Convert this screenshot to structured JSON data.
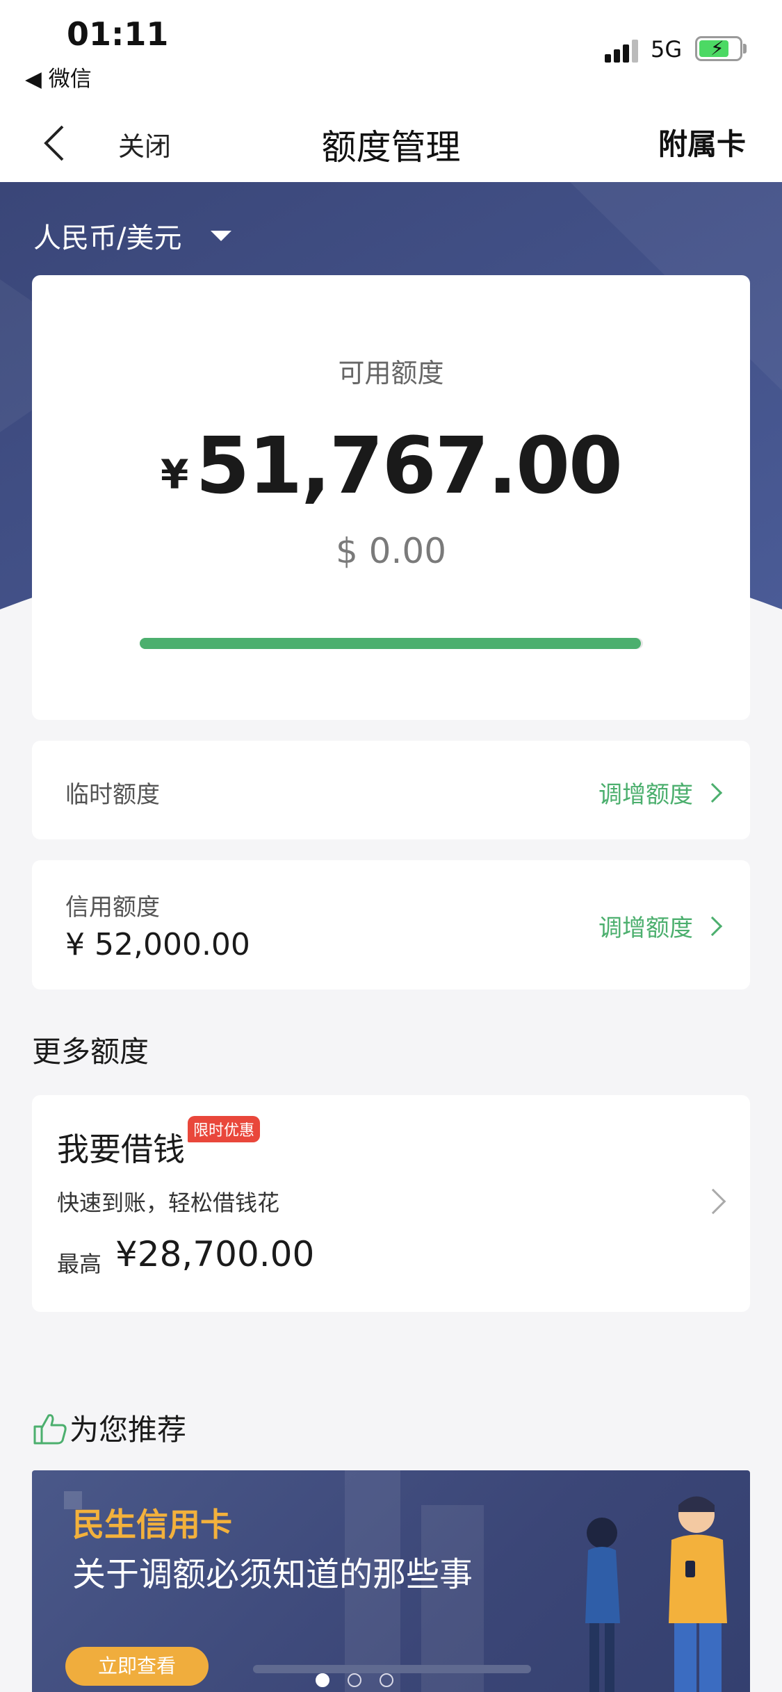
{
  "status_bar": {
    "time": "01:11",
    "back_app": "◀ 微信",
    "network": "5G",
    "battery_level": 0.75
  },
  "nav": {
    "close_label": "关闭",
    "title": "额度管理",
    "right_label": "附属卡"
  },
  "currency_selector": {
    "label": "人民币/美元"
  },
  "available": {
    "label": "可用额度",
    "currency_symbol": "¥",
    "amount": "51,767.00",
    "usd_amount": "$ 0.00",
    "usage_ratio": 0.9955
  },
  "temp_limit": {
    "label": "临时额度",
    "action": "调增额度"
  },
  "credit_limit": {
    "label": "信用额度",
    "value": "¥ 52,000.00",
    "action": "调增额度"
  },
  "more": {
    "title": "更多额度"
  },
  "loan": {
    "title": "我要借钱",
    "badge": "限时优惠",
    "desc": "快速到账，轻松借钱花",
    "max_label": "最高",
    "max_value": "¥28,700.00"
  },
  "recommend": {
    "title": "为您推荐"
  },
  "banner": {
    "brand": "民生信用卡",
    "headline": "关于调额必须知道的那些事",
    "button": "立即查看",
    "pages": 3,
    "active_page": 1
  },
  "colors": {
    "accent_green": "#4caf6e",
    "hero_navy": "#3b4677",
    "badge_red": "#e9473b",
    "banner_gold": "#f3b13c"
  }
}
